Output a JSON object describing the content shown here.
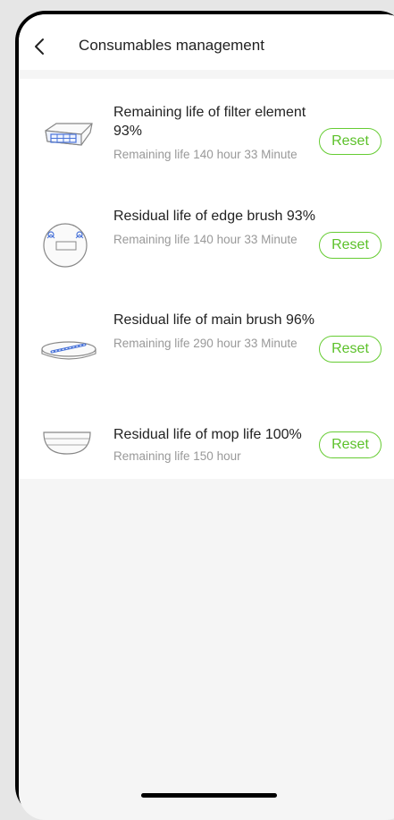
{
  "header": {
    "title": "Consumables management"
  },
  "items": [
    {
      "title": "Remaining life of filter element 93%",
      "subtitle": "Remaining life 140 hour 33 Minute",
      "icon": "filter-element-icon",
      "reset_label": "Reset"
    },
    {
      "title": "Residual life of edge brush 93%",
      "subtitle": "Remaining life 140 hour 33 Minute",
      "icon": "edge-brush-icon",
      "reset_label": "Reset"
    },
    {
      "title": "Residual life of main brush 96%",
      "subtitle": "Remaining life 290 hour 33 Minute",
      "icon": "main-brush-icon",
      "reset_label": "Reset"
    },
    {
      "title": "Residual life of mop life 100%",
      "subtitle": "Remaining life 150 hour",
      "icon": "mop-icon",
      "reset_label": "Reset"
    }
  ],
  "colors": {
    "accent": "#5cc12a",
    "background": "#f5f5f5"
  }
}
